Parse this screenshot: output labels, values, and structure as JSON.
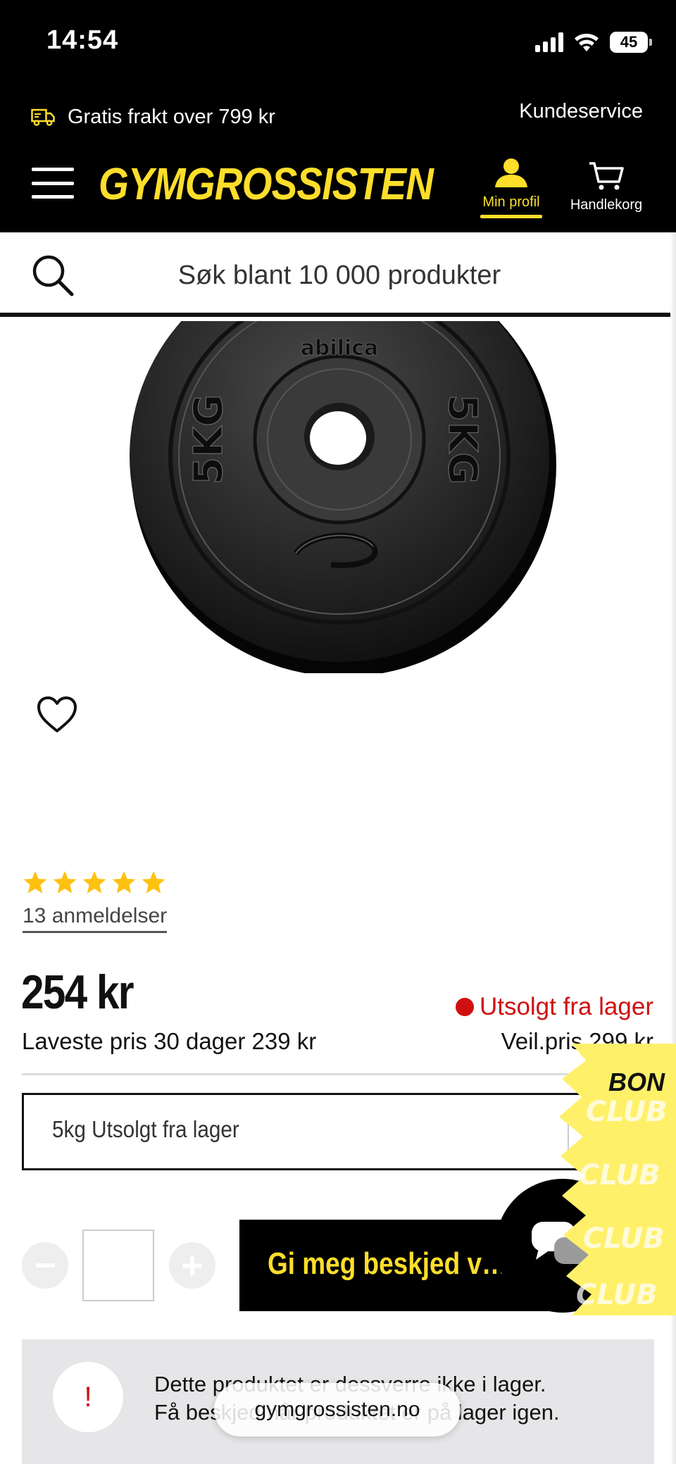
{
  "status_bar": {
    "time": "14:54",
    "battery": "45"
  },
  "header": {
    "promo_text": "Gratis frakt over 799 kr",
    "customer_service": "Kundeservice",
    "logo": "GYMGROSSISTEN",
    "profile_label": "Min profil",
    "cart_label": "Handlekorg",
    "accent_color": "#fede2a"
  },
  "search": {
    "placeholder": "Søk blant 10 000 produkter"
  },
  "product": {
    "image_text": {
      "brand": "abilica",
      "weight": "5KG"
    },
    "rating_stars": 5,
    "reviews_label": "13 anmeldelser",
    "price": "254 kr",
    "stock_status": "Utsolgt fra lager",
    "lowest_price": "Laveste pris 30 dager 239 kr",
    "recommended_price": "Veil.pris 299 kr",
    "variant_selected": "5kg Utsolgt fra lager",
    "quantity_value": "",
    "notify_button": "Gi meg beskjed v…",
    "stock_color": "#d01010"
  },
  "bonus_tab": {
    "label": "BON"
  },
  "notice": {
    "line1": "Dette produktet er dessverre ikke i lager.",
    "line2": "Få beskjed når produktet er på lager igen.",
    "badge": "!"
  },
  "browser": {
    "url": "gymgrossisten.no"
  }
}
